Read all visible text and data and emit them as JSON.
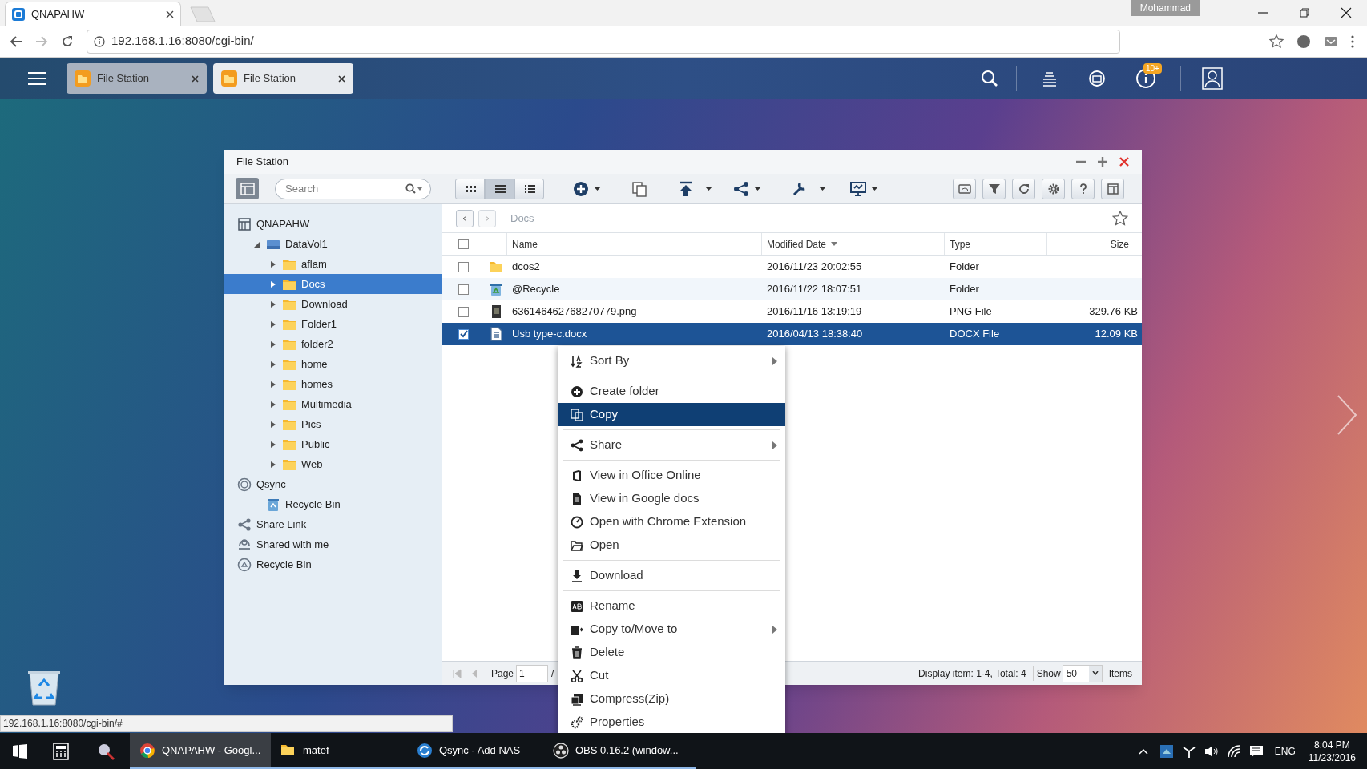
{
  "browser": {
    "tab_title": "QNAPAHW",
    "profile": "Mohammad",
    "address": "192.168.1.16:8080/cgi-bin/"
  },
  "app_bar": {
    "tabs": [
      {
        "label": "File Station",
        "selected": false
      },
      {
        "label": "File Station",
        "selected": true
      }
    ],
    "notification_badge": "10+"
  },
  "window": {
    "title": "File Station",
    "search": {
      "placeholder": "Search"
    },
    "views": [
      {
        "kind": "thumbnails",
        "selected": false
      },
      {
        "kind": "list",
        "selected": true
      },
      {
        "kind": "details",
        "selected": false
      }
    ]
  },
  "sidebar": {
    "items": [
      {
        "kind": "nas",
        "label": "QNAPAHW",
        "selected": false,
        "children": [
          {
            "kind": "volume",
            "label": "DataVol1",
            "selected": false,
            "expanded": true,
            "children": [
              {
                "kind": "folder",
                "label": "aflam",
                "selected": false,
                "expanded": false
              },
              {
                "kind": "folder",
                "label": "Docs",
                "selected": true,
                "expanded": false
              },
              {
                "kind": "folder",
                "label": "Download",
                "selected": false,
                "expanded": false
              },
              {
                "kind": "folder",
                "label": "Folder1",
                "selected": false,
                "expanded": false
              },
              {
                "kind": "folder",
                "label": "folder2",
                "selected": false,
                "expanded": false
              },
              {
                "kind": "folder",
                "label": "home",
                "selected": false,
                "expanded": false
              },
              {
                "kind": "folder",
                "label": "homes",
                "selected": false,
                "expanded": false
              },
              {
                "kind": "folder",
                "label": "Multimedia",
                "selected": false,
                "expanded": false
              },
              {
                "kind": "folder",
                "label": "Pics",
                "selected": false,
                "expanded": false
              },
              {
                "kind": "folder",
                "label": "Public",
                "selected": false,
                "expanded": false
              },
              {
                "kind": "folder",
                "label": "Web",
                "selected": false,
                "expanded": false
              }
            ]
          }
        ]
      },
      {
        "kind": "qsync",
        "label": "Qsync",
        "selected": false,
        "children": [
          {
            "kind": "recycle",
            "label": "Recycle Bin",
            "selected": false
          }
        ]
      },
      {
        "kind": "share",
        "label": "Share Link",
        "selected": false
      },
      {
        "kind": "shared",
        "label": "Shared with me",
        "selected": false
      },
      {
        "kind": "recycle_bin",
        "label": "Recycle Bin",
        "selected": false
      }
    ]
  },
  "breadcrumb": "Docs",
  "table": {
    "select_all": {
      "checked": false
    },
    "columns": [
      {
        "label": "Name",
        "sorted": false
      },
      {
        "label": "Modified Date",
        "sorted": true
      },
      {
        "label": "Type",
        "sorted": false
      },
      {
        "label": "Size",
        "sorted": false
      }
    ],
    "rows": [
      {
        "kind": "folder",
        "name": "dcos2",
        "modified": "2016/11/23 20:02:55",
        "type": "Folder",
        "checked": false,
        "selected": false
      },
      {
        "kind": "recycle",
        "name": "@Recycle",
        "modified": "2016/11/22 18:07:51",
        "type": "Folder",
        "checked": false,
        "selected": false
      },
      {
        "kind": "image",
        "name": "636146462768270779.png",
        "modified": "2016/11/16 13:19:19",
        "type": "PNG File",
        "size": "329.76 KB",
        "checked": false,
        "selected": false
      },
      {
        "kind": "document",
        "name": "Usb type-c.docx",
        "modified": "2016/04/13 18:38:40",
        "type": "DOCX File",
        "size": "12.09 KB",
        "checked": true,
        "selected": true
      }
    ]
  },
  "footer": {
    "page_label": "Page",
    "page": "1",
    "separator": "/",
    "display": "Display item: 1-4, Total: 4",
    "show_label": "Show",
    "per_page": "50",
    "items_label": "Items"
  },
  "context_menu": {
    "groups": [
      [
        {
          "kind": "sort",
          "label": "Sort By",
          "submenu": true,
          "selected": false
        }
      ],
      [
        {
          "kind": "create",
          "label": "Create folder",
          "submenu": false,
          "selected": false
        },
        {
          "kind": "copy",
          "label": "Copy",
          "submenu": false,
          "selected": true
        }
      ],
      [
        {
          "kind": "share",
          "label": "Share",
          "submenu": true,
          "selected": false
        }
      ],
      [
        {
          "kind": "office",
          "label": "View in Office Online",
          "submenu": false,
          "selected": false
        },
        {
          "kind": "gdocs",
          "label": "View in Google docs",
          "submenu": false,
          "selected": false
        },
        {
          "kind": "chrome",
          "label": "Open with Chrome Extension",
          "submenu": false,
          "selected": false
        },
        {
          "kind": "open",
          "label": "Open",
          "submenu": false,
          "selected": false
        }
      ],
      [
        {
          "kind": "download",
          "label": "Download",
          "submenu": false,
          "selected": false
        }
      ],
      [
        {
          "kind": "rename",
          "label": "Rename",
          "submenu": false,
          "selected": false
        },
        {
          "kind": "move",
          "label": "Copy to/Move to",
          "submenu": true,
          "selected": false
        },
        {
          "kind": "delete",
          "label": "Delete",
          "submenu": false,
          "selected": false
        },
        {
          "kind": "cut",
          "label": "Cut",
          "submenu": false,
          "selected": false
        },
        {
          "kind": "zip",
          "label": "Compress(Zip)",
          "submenu": false,
          "selected": false
        },
        {
          "kind": "properties",
          "label": "Properties",
          "submenu": false,
          "selected": false
        }
      ]
    ]
  },
  "status_url": "192.168.1.16:8080/cgi-bin/#",
  "taskbar": {
    "apps": [
      {
        "kind": "chrome",
        "label": "QNAPAHW - Googl...",
        "active": true
      },
      {
        "kind": "folder",
        "label": "matef",
        "active": false
      },
      {
        "kind": "qsync",
        "label": "Qsync - Add NAS",
        "active": false
      },
      {
        "kind": "obs",
        "label": "OBS 0.16.2 (window...",
        "active": false
      }
    ],
    "language": "ENG",
    "time": "8:04 PM",
    "date": "11/23/2016"
  }
}
